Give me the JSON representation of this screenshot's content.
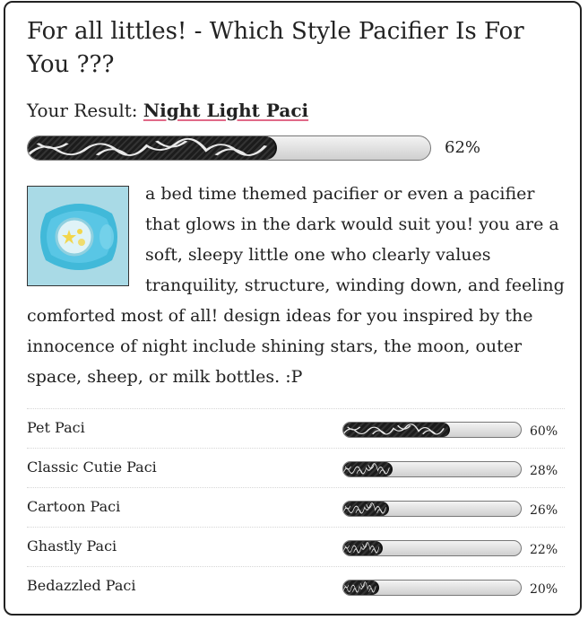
{
  "quiz": {
    "title": "For all littles! - Which Style Pacifier Is For You ???"
  },
  "result": {
    "prefix": "Your Result: ",
    "name": "Night Light Paci",
    "percent": 62,
    "percent_label": "62%",
    "image_icon": "pacifier-image",
    "description": "a bed time themed pacifier or even a pacifier that glows in the dark would suit you! you are a soft, sleepy little one who clearly values tranquility, structure, winding down, and feeling comforted most of all! design ideas for you inspired by the innocence of night include shining stars, the moon, outer space, sheep, or milk bottles. :P"
  },
  "other_results": [
    {
      "label": "Pet Paci",
      "percent": 60,
      "percent_label": "60%"
    },
    {
      "label": "Classic Cutie Paci",
      "percent": 28,
      "percent_label": "28%"
    },
    {
      "label": "Cartoon Paci",
      "percent": 26,
      "percent_label": "26%"
    },
    {
      "label": "Ghastly Paci",
      "percent": 22,
      "percent_label": "22%"
    },
    {
      "label": "Bedazzled Paci",
      "percent": 20,
      "percent_label": "20%"
    }
  ],
  "colors": {
    "bar_fill": "#1c1c1c",
    "bar_track": "#d9d9d9",
    "result_underline": "#e06a88",
    "text": "#222222"
  }
}
